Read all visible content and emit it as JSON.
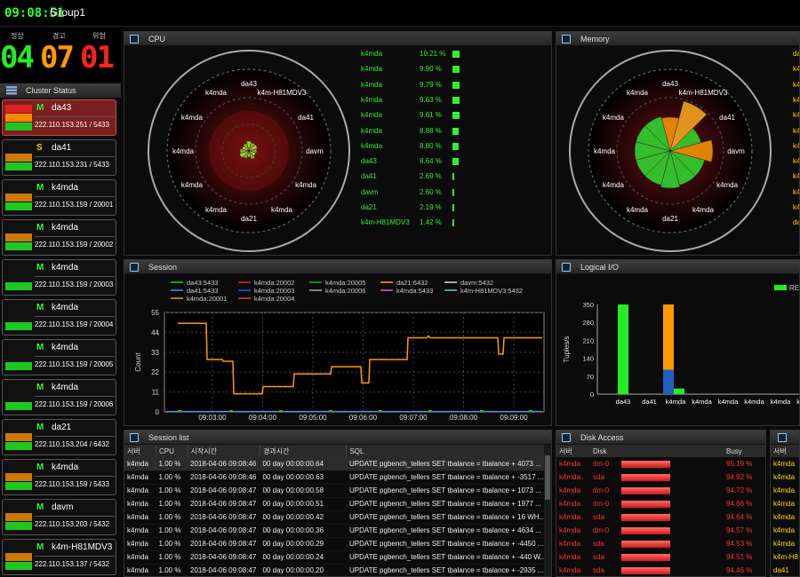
{
  "topbar": {
    "clock": "09:08:51",
    "group": "Group1"
  },
  "status": {
    "labels": {
      "normal": "정상",
      "warning": "경고",
      "danger": "위험"
    },
    "normal": "04",
    "warning": "07",
    "danger": "01",
    "colors": {
      "normal": "#22ee22",
      "warning": "#ff9900",
      "danger": "#ff2020"
    }
  },
  "cluster": {
    "title": "Cluster Status",
    "nodes": [
      {
        "role": "M",
        "name": "da43",
        "ip": "222.110.153.251 / 5433",
        "alert": true
      },
      {
        "role": "S",
        "name": "da41",
        "ip": "222.110.153.231 / 5433",
        "alert": false
      },
      {
        "role": "M",
        "name": "k4mda",
        "ip": "222.110.153.159 / 20001",
        "alert": false
      },
      {
        "role": "M",
        "name": "k4mda",
        "ip": "222.110.153.159 / 20002",
        "alert": false
      },
      {
        "role": "M",
        "name": "k4mda",
        "ip": "222.110.153.159 / 20003",
        "alert": false
      },
      {
        "role": "M",
        "name": "k4mda",
        "ip": "222.110.153.159 / 20004",
        "alert": false
      },
      {
        "role": "M",
        "name": "k4mda",
        "ip": "222.110.153.159 / 20005",
        "alert": false
      },
      {
        "role": "M",
        "name": "k4mda",
        "ip": "222.110.153.159 / 20006",
        "alert": false
      },
      {
        "role": "M",
        "name": "da21",
        "ip": "222.110.153.204 / 6432",
        "alert": false
      },
      {
        "role": "M",
        "name": "k4mda",
        "ip": "222.110.153.159 / 5433",
        "alert": false
      },
      {
        "role": "M",
        "name": "davm",
        "ip": "222.110.153.203 / 5432",
        "alert": false
      },
      {
        "role": "M",
        "name": "k4m-H81MDV3",
        "ip": "222.110.153.137 / 5432",
        "alert": false
      }
    ]
  },
  "cpu": {
    "title": "CPU",
    "radar_labels": [
      "da43",
      "k4m-H81MDV3",
      "da41",
      "davm",
      "k4mda",
      "k4mda",
      "da21",
      "k4mda",
      "k4mda",
      "k4mda",
      "k4mda",
      "k4mda"
    ],
    "list": [
      {
        "name": "k4mda",
        "value": "10.21 %",
        "pct": 10.21
      },
      {
        "name": "k4mda",
        "value": "9.90 %",
        "pct": 9.9
      },
      {
        "name": "k4mda",
        "value": "9.79 %",
        "pct": 9.79
      },
      {
        "name": "k4mda",
        "value": "9.63 %",
        "pct": 9.63
      },
      {
        "name": "k4mda",
        "value": "9.61 %",
        "pct": 9.61
      },
      {
        "name": "k4mda",
        "value": "8.88 %",
        "pct": 8.88
      },
      {
        "name": "k4mda",
        "value": "8.80 %",
        "pct": 8.8
      },
      {
        "name": "da43",
        "value": "8.64 %",
        "pct": 8.64
      },
      {
        "name": "da41",
        "value": "2.69 %",
        "pct": 2.69
      },
      {
        "name": "davm",
        "value": "2.60 %",
        "pct": 2.6
      },
      {
        "name": "da21",
        "value": "2.19 %",
        "pct": 2.19
      },
      {
        "name": "k4m-H81MDV3",
        "value": "1.42 %",
        "pct": 1.42
      }
    ]
  },
  "memory": {
    "title": "Memory",
    "radar_labels": [
      "da43",
      "k4m-H81MDV3",
      "da41",
      "davm",
      "k4mda",
      "k4mda",
      "da21",
      "k4mda",
      "k4mda",
      "k4mda",
      "k4mda",
      "k4mda"
    ],
    "list_prefix": [
      "da",
      "k4",
      "k4",
      "k4",
      "k4",
      "k4",
      "k4",
      "k4",
      "k4",
      "k4",
      "k4",
      "da"
    ]
  },
  "session": {
    "title": "Session",
    "legend": [
      {
        "name": "da43:5433",
        "color": "#22cc22"
      },
      {
        "name": "k4mda:20002",
        "color": "#ee2222"
      },
      {
        "name": "k4mda:20005",
        "color": "#22aa22"
      },
      {
        "name": "da21:6432",
        "color": "#ffaa00"
      },
      {
        "name": "davm:5432",
        "color": "#dddddd"
      },
      {
        "name": "da41:5433",
        "color": "#3399ff"
      },
      {
        "name": "k4mda:20003",
        "color": "#2255ff"
      },
      {
        "name": "k4mda:20006",
        "color": "#aaaaaa"
      },
      {
        "name": "k4mda:5433",
        "color": "#cc66cc"
      },
      {
        "name": "k4m-H81MDV3:5432",
        "color": "#66cccc"
      },
      {
        "name": "k4mda:20001",
        "color": "#ff9900"
      },
      {
        "name": "k4mda:20004",
        "color": "#cc4444"
      }
    ],
    "ylabel": "Count",
    "yticks": [
      "55",
      "44",
      "33",
      "22",
      "11",
      "0"
    ],
    "xticks": [
      "09:03:00",
      "09:04:00",
      "09:05:00",
      "09:06:00",
      "09:07:00",
      "09:08:00",
      "09:09:00"
    ]
  },
  "logical_io": {
    "title": "Logical I/O",
    "legend": "REA",
    "ylabel": "Tuples/s",
    "yticks": [
      "350",
      "280",
      "210",
      "140",
      "70",
      "0"
    ],
    "categories": [
      "da43",
      "da41",
      "k4mda",
      "k4mda",
      "k4mda",
      "k4mda",
      "k4mda",
      "k4mda"
    ]
  },
  "session_list": {
    "title": "Session list",
    "columns": [
      "서버",
      "CPU",
      "시작시간",
      "경과시간",
      "SQL"
    ],
    "rows": [
      [
        "k4mda",
        "1.00 %",
        "2018-04-06 09:08:46",
        "00 day 00:00:00.64",
        "UPDATE pgbench_tellers SET tbalance = tbalance + 4073 ..."
      ],
      [
        "k4mda",
        "1.00 %",
        "2018-04-06 09:08:46",
        "00 day 00:00:00.63",
        "UPDATE pgbench_tellers SET tbalance = tbalance + -3517 ..."
      ],
      [
        "k4mda",
        "1.00 %",
        "2018-04-06 09:08:47",
        "00 day 00:00:00.58",
        "UPDATE pgbench_tellers SET tbalance = tbalance + 1073 ..."
      ],
      [
        "k4mda",
        "1.00 %",
        "2018-04-06 09:08:47",
        "00 day 00:00:00.51",
        "UPDATE pgbench_tellers SET tbalance = tbalance + 1977 ..."
      ],
      [
        "k4mda",
        "1.00 %",
        "2018-04-06 09:08:47",
        "00 day 00:00:00.42",
        "UPDATE pgbench_tellers SET tbalance = tbalance + 16 WH..."
      ],
      [
        "k4mda",
        "1.00 %",
        "2018-04-06 09:08:47",
        "00 day 00:00:00.36",
        "UPDATE pgbench_tellers SET tbalance = tbalance + 4634 ..."
      ],
      [
        "k4mda",
        "1.00 %",
        "2018-04-06 09:08:47",
        "00 day 00:00:00.29",
        "UPDATE pgbench_tellers SET tbalance = tbalance + -4450 ..."
      ],
      [
        "k4mda",
        "1.00 %",
        "2018-04-06 09:08:47",
        "00 day 00:00:00.24",
        "UPDATE pgbench_tellers SET tbalance = tbalance + -440 W..."
      ],
      [
        "k4mda",
        "1.00 %",
        "2018-04-06 09:08:47",
        "00 day 00:00:00.20",
        "UPDATE pgbench_tellers SET tbalance = tbalance + -2935 ..."
      ]
    ]
  },
  "disk": {
    "title": "Disk Access",
    "columns": [
      "서버",
      "Disk",
      "",
      "Busy"
    ],
    "rows": [
      {
        "server": "k4mda",
        "disk": "dm-0",
        "busy": "95.19 %",
        "pct": 95.19
      },
      {
        "server": "k4mda",
        "disk": "sda",
        "busy": "94.92 %",
        "pct": 94.92
      },
      {
        "server": "k4mda",
        "disk": "dm-0",
        "busy": "94.72 %",
        "pct": 94.72
      },
      {
        "server": "k4mda",
        "disk": "dm-0",
        "busy": "94.66 %",
        "pct": 94.66
      },
      {
        "server": "k4mda",
        "disk": "sda",
        "busy": "94.64 %",
        "pct": 94.64
      },
      {
        "server": "k4mda",
        "disk": "dm-0",
        "busy": "94.57 %",
        "pct": 94.57
      },
      {
        "server": "k4mda",
        "disk": "sda",
        "busy": "94.53 %",
        "pct": 94.53
      },
      {
        "server": "k4mda",
        "disk": "sda",
        "busy": "94.51 %",
        "pct": 94.51
      },
      {
        "server": "k4mda",
        "disk": "sda",
        "busy": "94.46 %",
        "pct": 94.46
      }
    ]
  },
  "right_list": {
    "column": "서버",
    "rows": [
      "k4mda",
      "k4mda",
      "k4mda",
      "k4mda",
      "k4mda",
      "k4mda",
      "k4mda",
      "k4m-H8",
      "da41"
    ]
  }
}
